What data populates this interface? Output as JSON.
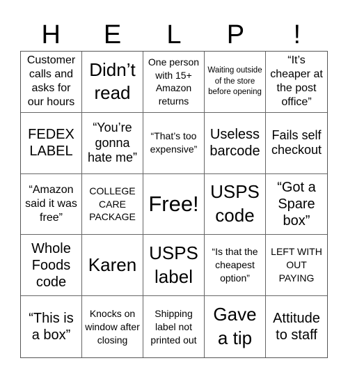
{
  "header": {
    "letters": [
      "H",
      "E",
      "L",
      "P",
      "!"
    ]
  },
  "grid": {
    "rows": [
      [
        {
          "text": "Customer calls and asks for our hours",
          "size": "m"
        },
        {
          "text": "Didn’t read",
          "size": "xxl"
        },
        {
          "text": "One person with 15+ Amazon returns",
          "size": "s"
        },
        {
          "text": "Waiting outside of the store before opening",
          "size": "xs"
        },
        {
          "text": "“It’s cheaper at the post office”",
          "size": "m"
        }
      ],
      [
        {
          "text": "FEDEX LABEL",
          "size": "xl"
        },
        {
          "text": "“You’re gonna hate me”",
          "size": "l"
        },
        {
          "text": "“That’s too expensive”",
          "size": "s"
        },
        {
          "text": "Useless barcode",
          "size": "xl"
        },
        {
          "text": "Fails self checkout",
          "size": "l"
        }
      ],
      [
        {
          "text": "“Amazon said it was free”",
          "size": "m"
        },
        {
          "text": "COLLEGE CARE PACKAGE",
          "size": "s"
        },
        {
          "text": "Free!",
          "size": "free"
        },
        {
          "text": "USPS code",
          "size": "xxl"
        },
        {
          "text": "“Got a Spare box”",
          "size": "xl"
        }
      ],
      [
        {
          "text": "Whole Foods code",
          "size": "xl"
        },
        {
          "text": "Karen",
          "size": "xxl"
        },
        {
          "text": "USPS label",
          "size": "xxl"
        },
        {
          "text": "“Is that the cheapest option”",
          "size": "s"
        },
        {
          "text": "LEFT WITH OUT PAYING",
          "size": "s"
        }
      ],
      [
        {
          "text": "“This is a box”",
          "size": "xl"
        },
        {
          "text": "Knocks on window after closing",
          "size": "s"
        },
        {
          "text": "Shipping label not printed out",
          "size": "s"
        },
        {
          "text": "Gave a tip",
          "size": "xxl"
        },
        {
          "text": "Attitude to staff",
          "size": "xl"
        }
      ]
    ]
  }
}
